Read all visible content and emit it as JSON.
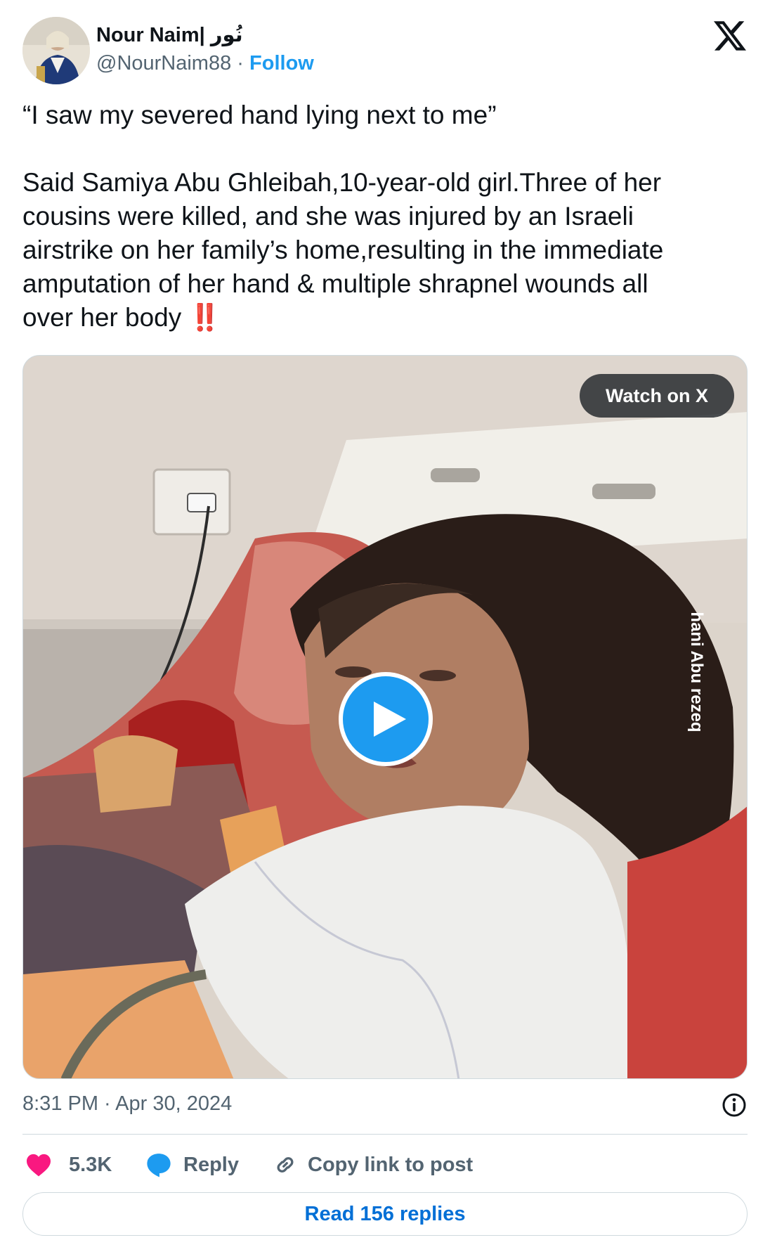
{
  "author": {
    "name": "Nour Naim| نُور",
    "handle": "@NourNaim88",
    "separator": "·",
    "follow_label": "Follow"
  },
  "tweet": {
    "lines_1": [
      "“I saw my severed hand lying next to me”"
    ],
    "lines_2": [
      "Said Samiya Abu Ghleibah,10-year-old girl.Three of her",
      "cousins were killed, and she was injured by an Israeli",
      "airstrike on her family’s home,resulting in the immediate",
      "amputation of her hand & multiple shrapnel wounds all",
      "over her body"
    ],
    "emoji": "‼️"
  },
  "media": {
    "watch_label": "Watch on X",
    "watermark": "hani Abu rezeq"
  },
  "timestamp": "8:31 PM · Apr 30, 2024",
  "actions": {
    "likes": "5.3K",
    "reply": "Reply",
    "copy": "Copy link to post"
  },
  "read_replies": "Read 156 replies",
  "colors": {
    "accent": "#1d9bf0",
    "like": "#f91880",
    "link": "#006fd6",
    "muted": "#536471"
  },
  "icons": [
    "x-logo-icon",
    "play-icon",
    "info-icon",
    "heart-icon",
    "reply-bubble-icon",
    "link-icon"
  ]
}
